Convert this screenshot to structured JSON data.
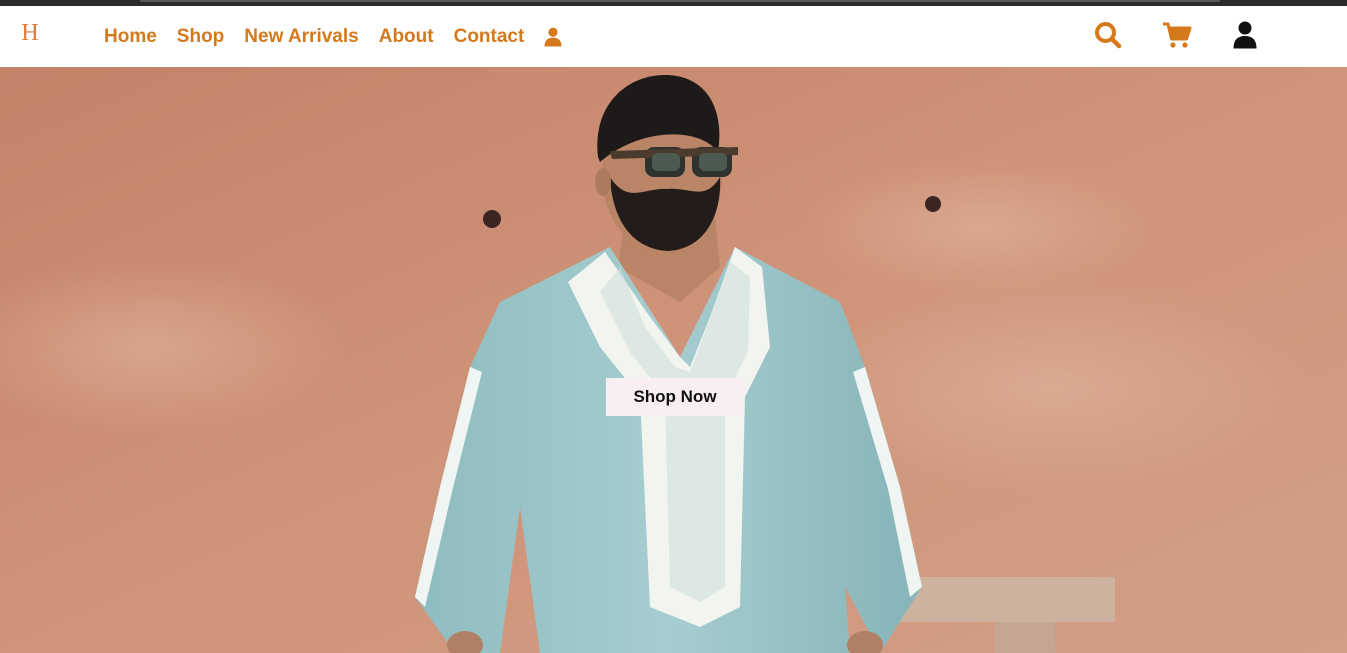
{
  "brand": {
    "logo_letter": "H",
    "logo_color": "#e07a3a"
  },
  "nav": {
    "links": [
      {
        "label": "Home"
      },
      {
        "label": "Shop"
      },
      {
        "label": "New Arrivals"
      },
      {
        "label": "About"
      },
      {
        "label": "Contact"
      }
    ],
    "link_color": "#d47a1c",
    "inline_icon": "user-icon"
  },
  "toolbar": {
    "icons": [
      "search-icon",
      "cart-icon",
      "account-icon"
    ],
    "accent_color": "#d47a1c",
    "account_icon_color": "#111111"
  },
  "hero": {
    "cta_label": "Shop Now",
    "cta_background": "#f9eef3",
    "wall_color": "#c98e72",
    "garment_color": "#98c3c6"
  }
}
